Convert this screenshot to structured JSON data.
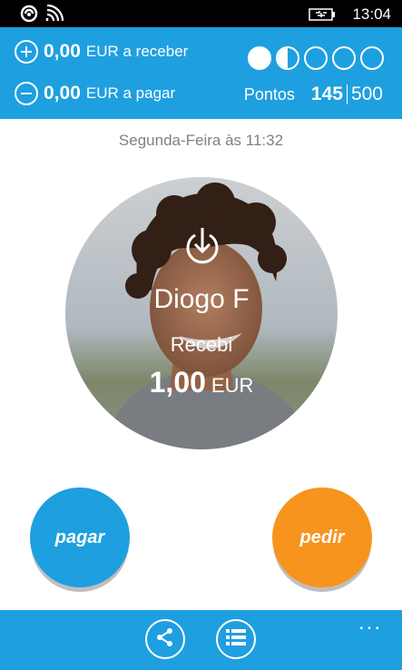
{
  "status_bar": {
    "time": "13:04",
    "icons": [
      "nfc-icon",
      "wifi-icon",
      "battery-charging-icon"
    ]
  },
  "header": {
    "receive": {
      "amount": "0,00",
      "label": "EUR a receber",
      "icon": "plus-circle-icon"
    },
    "pay": {
      "amount": "0,00",
      "label": "EUR a pagar",
      "icon": "minus-circle-icon"
    },
    "level": {
      "filled": 1.5,
      "total": 5
    },
    "points": {
      "label": "Pontos",
      "value": "145",
      "max": "500"
    }
  },
  "transaction": {
    "datetime": "Segunda-Feira às 11:32",
    "contact_name": "Diogo F",
    "type": "Recebi",
    "amount": "1,00",
    "currency": "EUR",
    "icon": "download-icon"
  },
  "actions": {
    "pay_label": "pagar",
    "ask_label": "pedir"
  },
  "app_bar": {
    "icons": [
      "share-icon",
      "list-icon"
    ],
    "more": "..."
  },
  "colors": {
    "primary_blue": "#1e9fe0",
    "orange": "#f7941d",
    "gray_text": "#808080"
  }
}
